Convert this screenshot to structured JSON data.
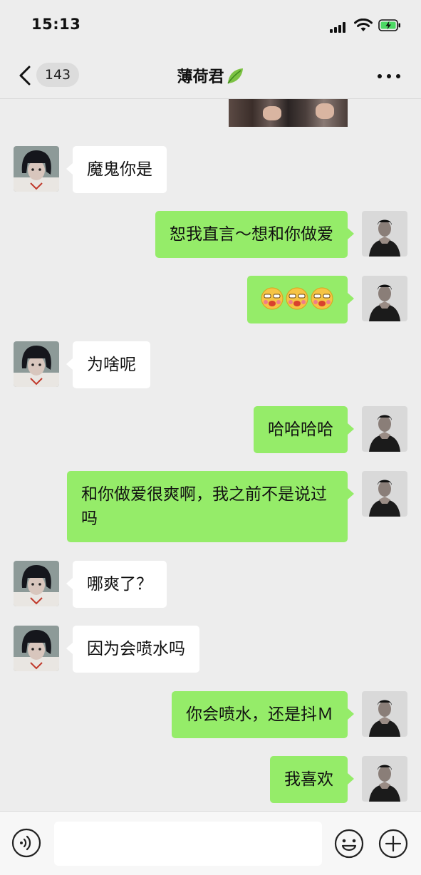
{
  "status_bar": {
    "time": "15:13",
    "battery_charging": true
  },
  "nav": {
    "unread_count": "143",
    "title": "薄荷君",
    "title_icon": "leaf-icon",
    "more_icon": "more-icon",
    "back_icon": "chevron-left-icon"
  },
  "colors": {
    "background": "#ededed",
    "bubble_self": "#95ec69",
    "bubble_other": "#ffffff",
    "battery_green": "#4cd964"
  },
  "messages": [
    {
      "sender": "other",
      "text": "魔鬼你是"
    },
    {
      "sender": "self",
      "text": "恕我直言～想和你做爱"
    },
    {
      "sender": "self",
      "text": "",
      "emoji": [
        "face-emoji",
        "face-emoji",
        "face-emoji"
      ]
    },
    {
      "sender": "other",
      "text": "为啥呢"
    },
    {
      "sender": "self",
      "text": "哈哈哈哈"
    },
    {
      "sender": "self",
      "text": "和你做爱很爽啊，我之前不是说过吗"
    },
    {
      "sender": "other",
      "text": "哪爽了？"
    },
    {
      "sender": "other",
      "text": "因为会喷水吗"
    },
    {
      "sender": "self",
      "text": "你会喷水，还是抖Ｍ"
    },
    {
      "sender": "self",
      "text": "我喜欢"
    }
  ],
  "input_bar": {
    "placeholder": "",
    "voice_icon": "voice-icon",
    "emoji_icon": "smiley-icon",
    "plus_icon": "plus-icon"
  }
}
